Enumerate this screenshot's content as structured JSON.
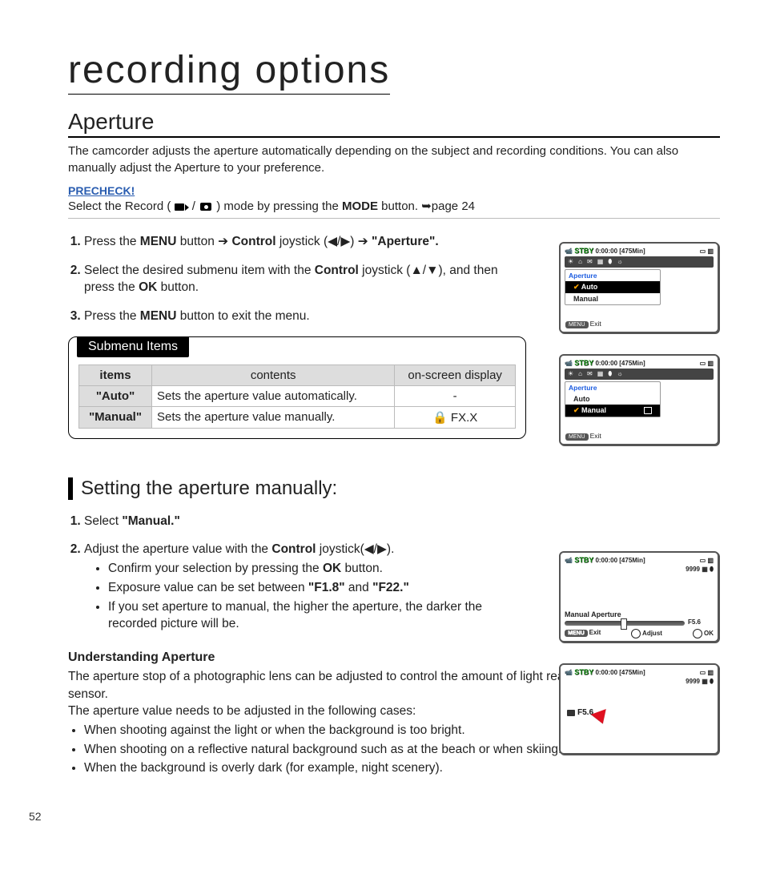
{
  "page_number": "52",
  "chapter_title": "recording options",
  "section": {
    "title": "Aperture",
    "intro": "The camcorder adjusts the aperture automatically depending on the subject and recording conditions. You can also manually adjust the Aperture to your preference."
  },
  "precheck": {
    "label": "PRECHECK!",
    "prefix": "Select the Record ( ",
    "mid": " / ",
    "suffix_a": " ) mode by pressing the ",
    "mode": "MODE",
    "suffix_b": " button. ➥page 24"
  },
  "steps": {
    "s1": {
      "p1": "Press the ",
      "b1": "MENU",
      "p2": " button ➔ ",
      "b2": "Control",
      "p3": " joystick (◀/▶) ➔ ",
      "b3": "\"Aperture\"."
    },
    "s2": {
      "p1": "Select the desired submenu item with the ",
      "b1": "Control",
      "p2": " joystick (▲/▼), and then press the ",
      "b2": "OK",
      "p3": " button."
    },
    "s3": {
      "p1": "Press the ",
      "b1": "MENU",
      "p2": " button to exit the menu."
    }
  },
  "submenu": {
    "title": "Submenu Items",
    "headers": {
      "items": "items",
      "contents": "contents",
      "display": "on-screen display"
    },
    "rows": [
      {
        "item": "\"Auto\"",
        "content": "Sets the aperture value automatically.",
        "display": "-"
      },
      {
        "item": "\"Manual\"",
        "content": "Sets the aperture value manually.",
        "display": "🔒 FX.X"
      }
    ]
  },
  "subsection_title": "Setting the aperture manually:",
  "manual_steps": {
    "s1": {
      "p1": "Select ",
      "b1": "\"Manual.\""
    },
    "s2": {
      "p1": "Adjust the aperture value with the ",
      "b1": "Control",
      "p2": " joystick(◀/▶)."
    },
    "bullets": {
      "b1": {
        "p1": "Confirm your selection by pressing the ",
        "bold": "OK",
        "p2": " button."
      },
      "b2": {
        "p1": "Exposure value can be set between ",
        "b1": "\"F1.8\"",
        "p2": " and ",
        "b2": "\"F22.\""
      },
      "b3": "If you set aperture to manual, the higher the aperture, the darker the recorded picture will be."
    }
  },
  "understanding": {
    "title": "Understanding Aperture",
    "body_1": "The aperture stop of a photographic lens can be adjusted to control the amount of light reaching the film or image sensor.",
    "body_2": "The aperture value needs to be adjusted in the following cases:",
    "conditions": [
      "When shooting against the light or when the background is too bright.",
      "When shooting on a reflective natural background such as at the beach or when skiing.",
      "When the background is overly dark (for example, night scenery)."
    ]
  },
  "lcd": {
    "stby": "STBY",
    "timecode": "0:00:00",
    "remain": "[475Min]",
    "menu_title": "Aperture",
    "auto": "Auto",
    "manual": "Manual",
    "menu_btn": "MENU",
    "exit": "Exit",
    "counter": "9999",
    "manual_aperture": "Manual Aperture",
    "fvalue": "F5.6",
    "adjust": "Adjust",
    "ok": "OK"
  }
}
